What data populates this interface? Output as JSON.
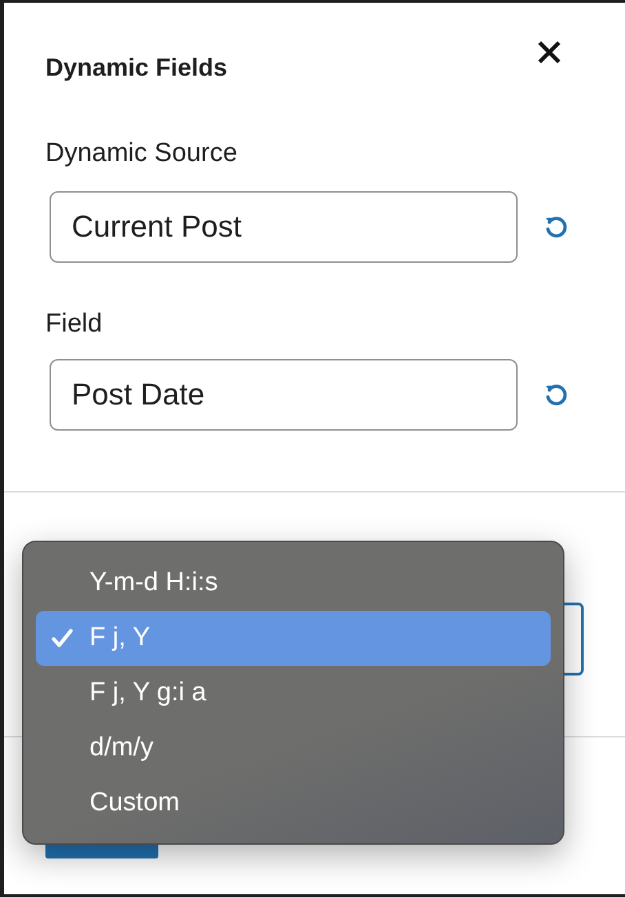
{
  "panel": {
    "title": "Dynamic Fields"
  },
  "fields": [
    {
      "label": "Dynamic Source",
      "value": "Current Post"
    },
    {
      "label": "Field",
      "value": "Post Date"
    }
  ],
  "format_menu": {
    "options": [
      {
        "label": "Y-m-d H:i:s",
        "selected": false
      },
      {
        "label": "F j, Y",
        "selected": true
      },
      {
        "label": "F j, Y g:i a",
        "selected": false
      },
      {
        "label": "d/m/y",
        "selected": false
      },
      {
        "label": "Custom",
        "selected": false
      }
    ]
  }
}
